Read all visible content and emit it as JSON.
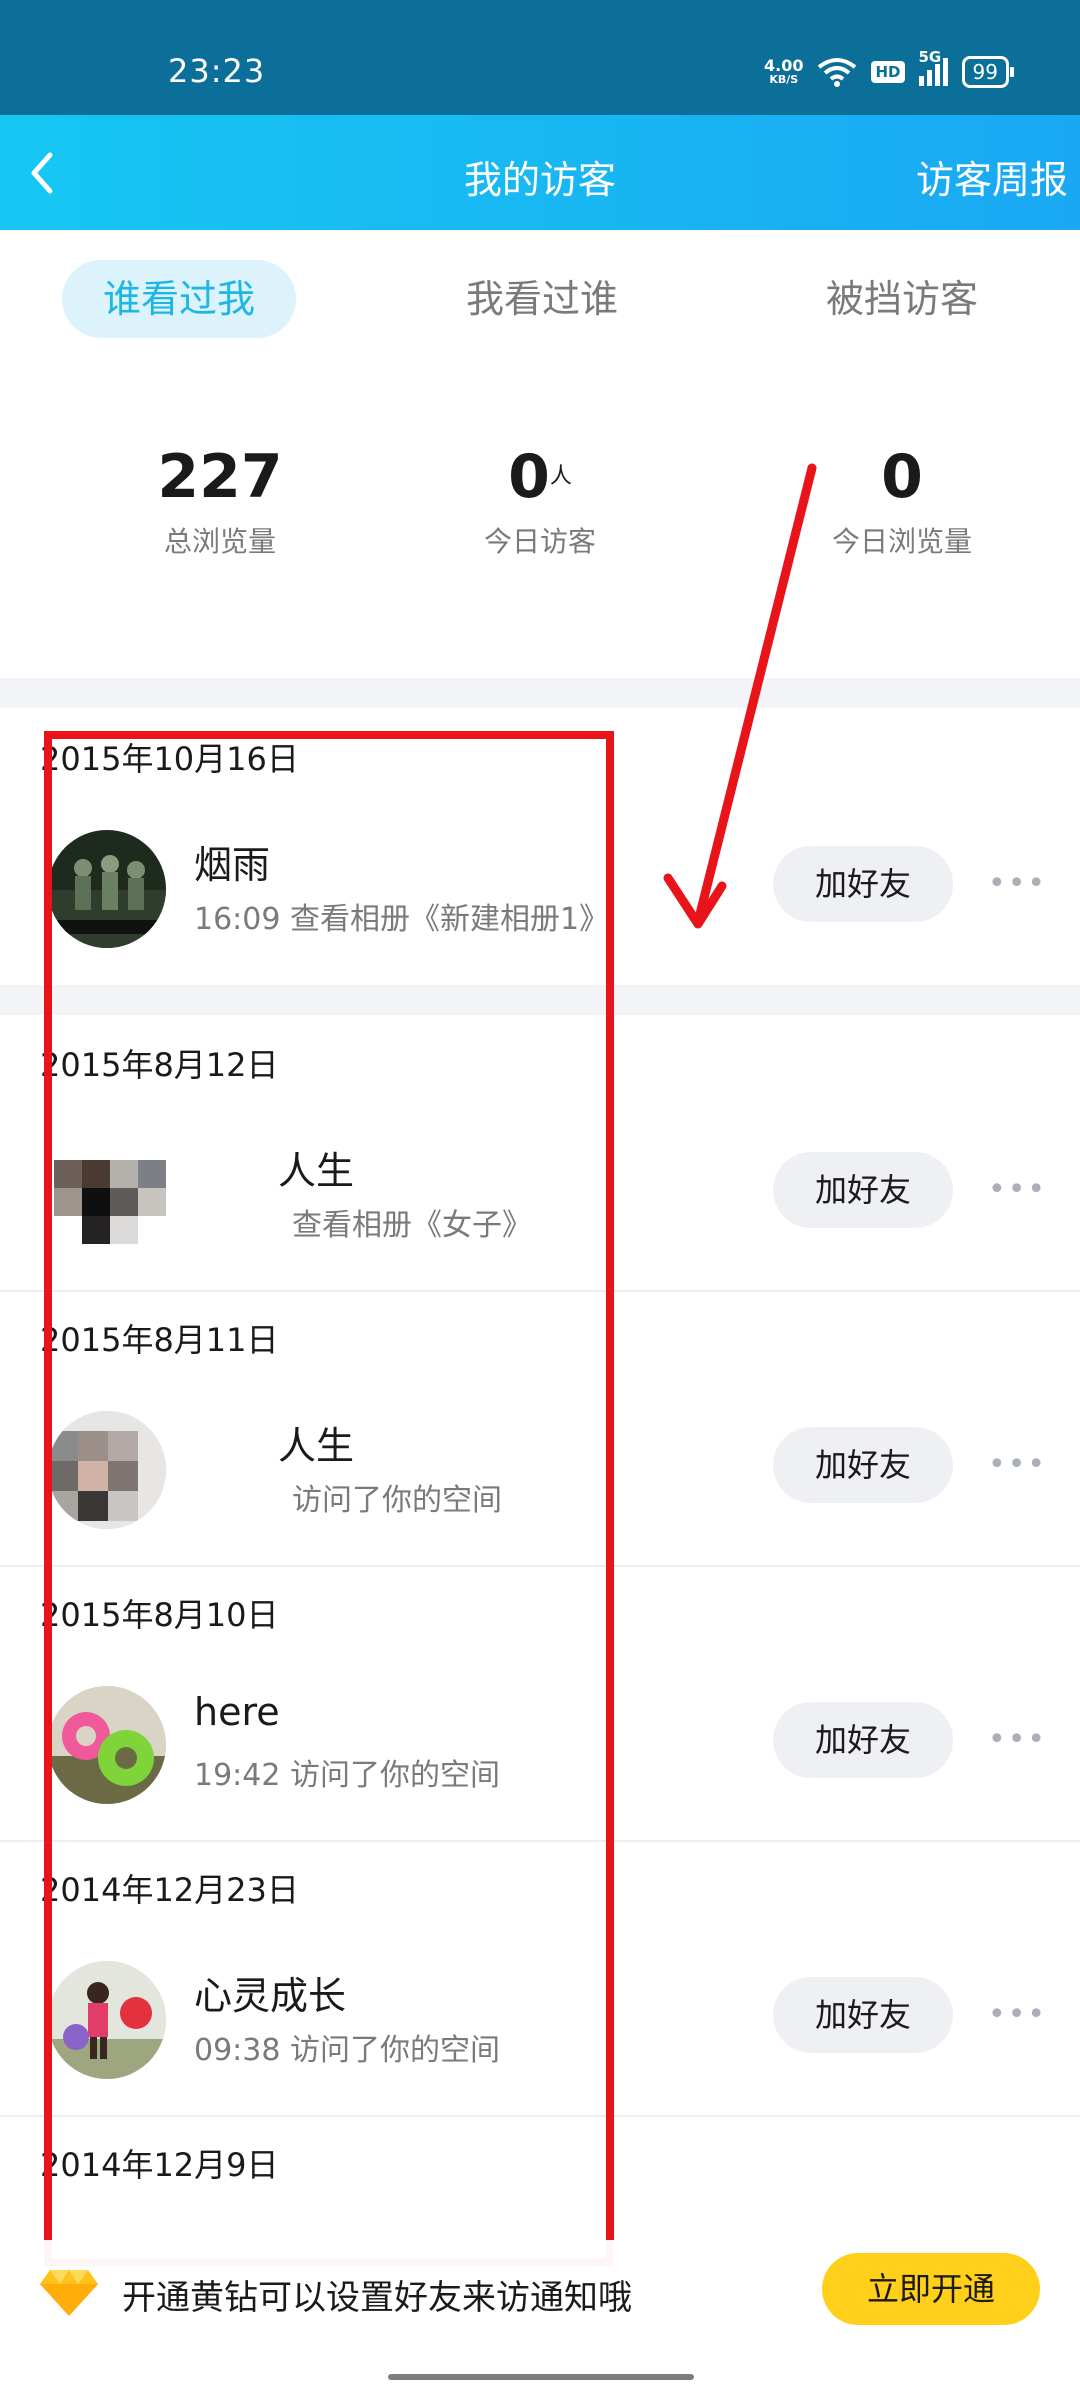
{
  "status_bar": {
    "time": "23:23",
    "net_speed_value": "4.00",
    "net_speed_unit": "KB/S",
    "hd_label": "HD",
    "network_label": "5G",
    "battery": "99"
  },
  "nav": {
    "title": "我的访客",
    "right_label": "访客周报",
    "colors": {
      "nav_start": "#16c7f3",
      "nav_end": "#1aa8f3"
    }
  },
  "tabs": [
    {
      "label": "谁看过我",
      "active": true
    },
    {
      "label": "我看过谁",
      "active": false
    },
    {
      "label": "被挡访客",
      "active": false
    }
  ],
  "stats": {
    "total_views": {
      "value": "227",
      "label": "总浏览量"
    },
    "today_visitors": {
      "value": "0",
      "unit": "人",
      "label": "今日访客"
    },
    "today_views": {
      "value": "0",
      "label": "今日浏览量"
    }
  },
  "visitor_groups": [
    {
      "date": "2015年10月16日",
      "visitor": {
        "name": "烟雨",
        "time": "16:09",
        "action": "查看相册《新建相册1》",
        "button": "加好友",
        "avatar_icon": "soldiers-photo-avatar"
      }
    },
    {
      "date": "2015年8月12日",
      "visitor": {
        "name": "人生",
        "time": "",
        "action": "查看相册《女子》",
        "button": "加好友",
        "avatar_icon": "pixelated-avatar"
      }
    },
    {
      "date": "2015年8月11日",
      "visitor": {
        "name": "人生",
        "time": "",
        "action": "访问了你的空间",
        "button": "加好友",
        "avatar_icon": "pixelated-avatar"
      }
    },
    {
      "date": "2015年8月10日",
      "visitor": {
        "name": "here",
        "time": "19:42",
        "action": "访问了你的空间",
        "button": "加好友",
        "avatar_icon": "swim-ring-avatar"
      }
    },
    {
      "date": "2014年12月23日",
      "visitor": {
        "name": "心灵成长",
        "time": "09:38",
        "action": "访问了你的空间",
        "button": "加好友",
        "avatar_icon": "child-balloons-avatar"
      }
    }
  ],
  "trailing_date": "2014年12月9日",
  "banner": {
    "text": "开通黄钻可以设置好友来访通知哦",
    "button": "立即开通",
    "accent": "#ffcf1a"
  }
}
